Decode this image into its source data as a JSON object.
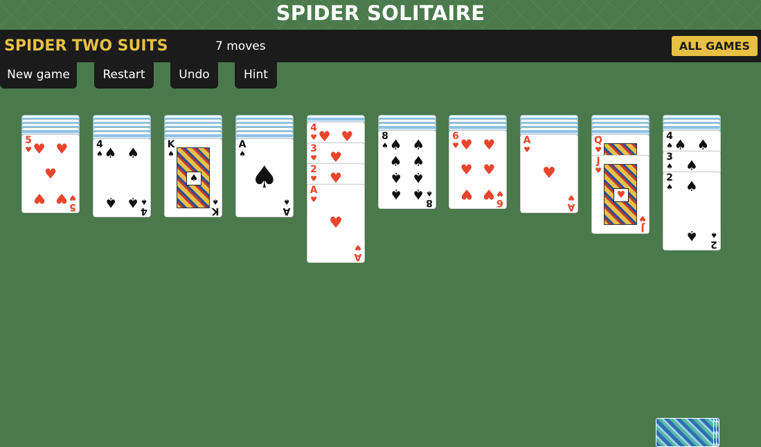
{
  "title": "SPIDER SOLITAIRE",
  "toolbar": {
    "variant": "SPIDER TWO SUITS",
    "moves": "7 moves",
    "all_games": "ALL GAMES"
  },
  "controls": {
    "new_game": "New game",
    "restart": "Restart",
    "undo": "Undo",
    "hint": "Hint"
  },
  "colors": {
    "felt": "#4a7a4c",
    "bar": "#1b1b1b",
    "accent": "#e8c044",
    "red_suit": "#e8452c"
  },
  "tableau": [
    {
      "facedown": 4,
      "faceup": [
        {
          "rank": "5",
          "suit": "hearts"
        }
      ]
    },
    {
      "facedown": 5,
      "faceup": [
        {
          "rank": "4",
          "suit": "spades"
        }
      ]
    },
    {
      "facedown": 5,
      "faceup": [
        {
          "rank": "K",
          "suit": "spades"
        }
      ]
    },
    {
      "facedown": 5,
      "faceup": [
        {
          "rank": "A",
          "suit": "spades"
        }
      ]
    },
    {
      "facedown": 1,
      "faceup": [
        {
          "rank": "4",
          "suit": "hearts"
        },
        {
          "rank": "3",
          "suit": "hearts"
        },
        {
          "rank": "2",
          "suit": "hearts"
        },
        {
          "rank": "A",
          "suit": "hearts"
        }
      ]
    },
    {
      "facedown": 3,
      "faceup": [
        {
          "rank": "8",
          "suit": "spades"
        }
      ]
    },
    {
      "facedown": 3,
      "faceup": [
        {
          "rank": "6",
          "suit": "hearts"
        }
      ]
    },
    {
      "facedown": 4,
      "faceup": [
        {
          "rank": "A",
          "suit": "hearts"
        }
      ]
    },
    {
      "facedown": 4,
      "faceup": [
        {
          "rank": "Q",
          "suit": "hearts"
        },
        {
          "rank": "J",
          "suit": "hearts"
        }
      ]
    },
    {
      "facedown": 3,
      "faceup": [
        {
          "rank": "4",
          "suit": "spades"
        },
        {
          "rank": "3",
          "suit": "spades"
        },
        {
          "rank": "2",
          "suit": "spades"
        }
      ]
    }
  ],
  "stock": {
    "visible_stacks": 1
  }
}
